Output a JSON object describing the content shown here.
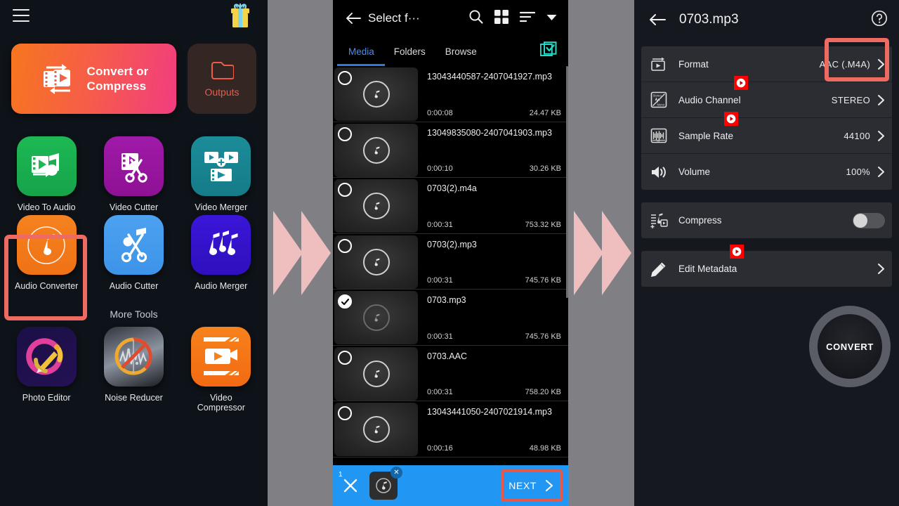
{
  "left_panel": {
    "menu_icon": "hamburger-menu-icon",
    "gift_icon": "gift-box-icon",
    "convert_card": {
      "label": "Convert or\nCompress",
      "line1": "Convert or",
      "line2": "Compress",
      "icon": "convert-video-icon"
    },
    "outputs_card": {
      "label": "Outputs",
      "icon": "folder-icon",
      "color": "#ef5a48"
    },
    "tools": [
      {
        "label": "Video To Audio",
        "icon": "video-to-audio-icon",
        "color": "#1db954"
      },
      {
        "label": "Video Cutter",
        "icon": "video-cutter-icon",
        "color": "#a01aa9"
      },
      {
        "label": "Video Merger",
        "icon": "video-merger-icon",
        "color": "#1c8c99"
      },
      {
        "label": "Audio Converter",
        "icon": "audio-converter-icon",
        "color": "#f58220",
        "highlighted": true
      },
      {
        "label": "Audio Cutter",
        "icon": "audio-cutter-icon",
        "color": "#4ca2f0"
      },
      {
        "label": "Audio Merger",
        "icon": "audio-merger-icon",
        "color": "#3a16d8"
      }
    ],
    "more_tools_heading": "More Tools",
    "more_tools": [
      {
        "label": "Photo Editor",
        "icon": "photo-editor-icon",
        "color": "#1b1046"
      },
      {
        "label": "Noise Reducer",
        "icon": "noise-reducer-icon",
        "color": "#8b93a0"
      },
      {
        "label": "Video Compressor",
        "line1": "Video",
        "line2": "Compressor",
        "icon": "video-compressor-icon",
        "color": "#f7821c"
      }
    ]
  },
  "mid_panel": {
    "back_icon": "back-arrow-icon",
    "title": "Select f···",
    "search_icon": "search-icon",
    "grid_icon": "grid-view-icon",
    "sort_icon": "sort-icon",
    "dropdown_icon": "chevron-down-icon",
    "select_all_icon": "select-all-checkbox-icon",
    "tabs": [
      {
        "label": "Media",
        "active": true
      },
      {
        "label": "Folders",
        "active": false
      },
      {
        "label": "Browse",
        "active": false
      }
    ],
    "files": [
      {
        "name": "13043440587-2407041927.mp3",
        "duration": "0:00:08",
        "size": "24.47 KB",
        "selected": false
      },
      {
        "name": "13049835080-2407041903.mp3",
        "duration": "0:00:10",
        "size": "30.26 KB",
        "selected": false
      },
      {
        "name": "0703(2).m4a",
        "duration": "0:00:31",
        "size": "753.32 KB",
        "selected": false
      },
      {
        "name": "0703(2).mp3",
        "duration": "0:00:31",
        "size": "745.76 KB",
        "selected": false
      },
      {
        "name": "0703.mp3",
        "duration": "0:00:31",
        "size": "745.76 KB",
        "selected": true
      },
      {
        "name": "0703.AAC",
        "duration": "0:00:31",
        "size": "758.20 KB",
        "selected": false
      },
      {
        "name": "13043441050-2407021914.mp3",
        "duration": "0:00:16",
        "size": "48.98 KB",
        "selected": false
      }
    ],
    "bottom_bar": {
      "clear_icon": "close-x-icon",
      "chip_count": "1",
      "chip_remove_icon": "chip-remove-x-icon",
      "chip_icon": "music-note-icon",
      "next_label": "NEXT",
      "next_chevron": "chevron-right-icon",
      "bar_color": "#2196f3",
      "highlight_color": "#e5584a"
    }
  },
  "right_panel": {
    "back_icon": "back-arrow-icon",
    "title": "0703.mp3",
    "help_icon": "help-circle-icon",
    "settings": [
      {
        "label": "Format",
        "value": "AAC (.M4A)",
        "icon": "format-video-icon",
        "badge": false,
        "highlighted": true
      },
      {
        "label": "Audio Channel",
        "value": "STEREO",
        "icon": "stereo-mono-icon",
        "badge": true
      },
      {
        "label": "Sample Rate",
        "value": "44100",
        "icon": "sample-rate-icon",
        "badge": true
      },
      {
        "label": "Volume",
        "value": "100%",
        "icon": "volume-icon",
        "badge": false
      }
    ],
    "compress": {
      "label": "Compress",
      "icon": "compress-icon",
      "toggle_on": false
    },
    "metadata": {
      "label": "Edit Metadata",
      "icon": "pencil-icon",
      "badge": true
    },
    "convert_button": {
      "label": "CONVERT"
    },
    "badge_color": "#ff0000",
    "highlight_color": "#ef6b62"
  },
  "separators": {
    "arrow_color": "#efbfc0",
    "band_color": "#808084"
  }
}
